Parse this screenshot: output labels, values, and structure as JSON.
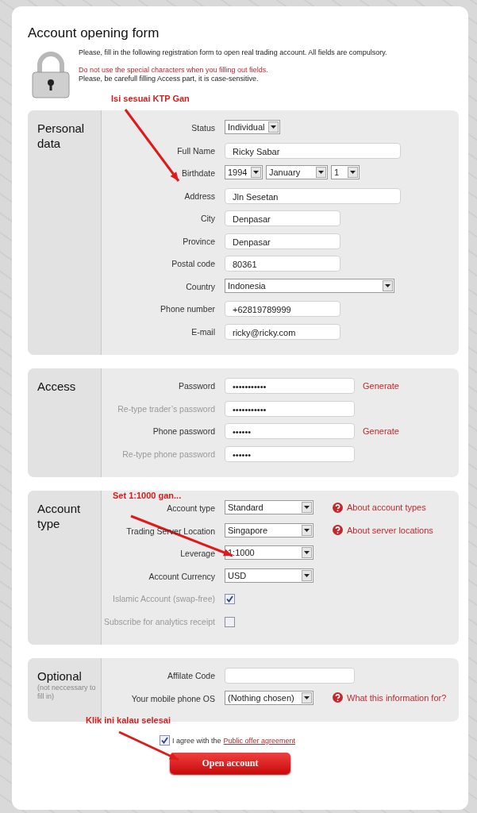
{
  "title": "Account opening form",
  "intro": "Please, fill in the following registration form to open real trading account. All fields are compulsory.",
  "warning": "Do not use the special characters when you filling out fields.",
  "note": "Please, be carefull filling Access part, it is case-sensitive.",
  "sections": [
    {
      "title": "Personal data",
      "rows": [
        {
          "kind": "select",
          "label": "Status",
          "value": "Individual",
          "disabled": false
        },
        {
          "kind": "text",
          "label": "Full Name",
          "value": "Ricky Sabar",
          "disabled": false
        },
        {
          "kind": "date",
          "label": "Birthdate",
          "parts": [
            "1994",
            "January",
            "1"
          ],
          "disabled": false
        },
        {
          "kind": "text",
          "label": "Address",
          "value": "Jln Sesetan",
          "disabled": false
        },
        {
          "kind": "text",
          "label": "City",
          "value": "Denpasar",
          "disabled": false
        },
        {
          "kind": "text",
          "label": "Province",
          "value": "Denpasar",
          "disabled": false
        },
        {
          "kind": "text",
          "label": "Postal code",
          "value": "80361",
          "disabled": false
        },
        {
          "kind": "select",
          "label": "Country",
          "value": "Indonesia",
          "disabled": false
        },
        {
          "kind": "text",
          "label": "Phone number",
          "value": "+62819789999",
          "disabled": false
        },
        {
          "kind": "text",
          "label": "E-mail",
          "value": "ricky@ricky.com",
          "disabled": false
        }
      ]
    },
    {
      "title": "Access",
      "rows": [
        {
          "kind": "password",
          "label": "Password",
          "value": "•••••••••••",
          "action": "Generate",
          "disabled": false
        },
        {
          "kind": "password",
          "label": "Re-type trader’s password",
          "value": "•••••••••••",
          "disabled": true
        },
        {
          "kind": "password",
          "label": "Phone password",
          "value": "••••••",
          "action": "Generate",
          "disabled": false
        },
        {
          "kind": "password",
          "label": "Re-type phone password",
          "value": "••••••",
          "disabled": true
        }
      ]
    },
    {
      "title": "Account type",
      "rows": [
        {
          "kind": "select",
          "label": "Account type",
          "value": "Standard",
          "help": "About account types",
          "disabled": false
        },
        {
          "kind": "select",
          "label": "Trading Server Location",
          "value": "Singapore",
          "help": "About server locations",
          "disabled": false
        },
        {
          "kind": "select",
          "label": "Leverage",
          "value": "1:1000",
          "disabled": false
        },
        {
          "kind": "select",
          "label": "Account Currency",
          "value": "USD",
          "disabled": false
        },
        {
          "kind": "checkbox",
          "label": "Islamic Account (swap-free)",
          "checked": true,
          "disabled": true
        },
        {
          "kind": "checkbox",
          "label": "Subscribe for analytics receipt",
          "checked": false,
          "disabled": true
        }
      ]
    },
    {
      "title": "Optional",
      "subtitle": "(not neccessary to fill in)",
      "rows": [
        {
          "kind": "text",
          "label": "Affilate Code",
          "value": "",
          "disabled": false
        },
        {
          "kind": "select",
          "label": "Your mobile phone OS",
          "value": "(Nothing chosen)",
          "help": "What this information for?",
          "disabled": false
        }
      ]
    }
  ],
  "agree": {
    "checked": true,
    "text": "I agree with the",
    "link": "Public offer agreement"
  },
  "submit": "Open account",
  "annotations": [
    "Isi sesuai KTP Gan",
    "Set 1:1000 gan...",
    "Klik ini kalau selesai"
  ]
}
